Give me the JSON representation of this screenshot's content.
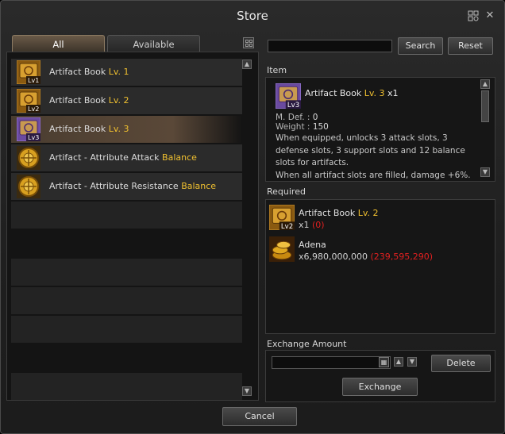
{
  "window": {
    "title": "Store"
  },
  "tabs": [
    {
      "label": "All",
      "active": true
    },
    {
      "label": "Available",
      "active": false
    }
  ],
  "list": [
    {
      "name": "Artifact Book",
      "suffix": "Lv. 1",
      "icon": "artifact-book-lv1-icon",
      "badge": "Lv1"
    },
    {
      "name": "Artifact Book",
      "suffix": "Lv. 2",
      "icon": "artifact-book-lv2-icon",
      "badge": "Lv2"
    },
    {
      "name": "Artifact Book",
      "suffix": "Lv. 3",
      "icon": "artifact-book-lv3-icon",
      "badge": "Lv3"
    },
    {
      "name": "Artifact - Attribute Attack",
      "suffix": "Balance",
      "icon": "artifact-attack-icon"
    },
    {
      "name": "Artifact - Attribute Resistance",
      "suffix": "Balance",
      "icon": "artifact-resistance-icon"
    }
  ],
  "search": {
    "value": "",
    "search_label": "Search",
    "reset_label": "Reset"
  },
  "item": {
    "section_label": "Item",
    "name": "Artifact Book",
    "level": "Lv. 3",
    "qty": "x1",
    "badge": "Lv3",
    "mdef_label": "M. Def. :",
    "mdef_value": "0",
    "weight_label": "Weight :",
    "weight_value": "150",
    "description": "When equipped, unlocks 3 attack slots, 3 defense slots, 3 support slots and 12 balance slots for artifacts.",
    "description2": "When all artifact slots are filled, damage +6%."
  },
  "required": {
    "section_label": "Required",
    "entries": [
      {
        "name": "Artifact Book",
        "level": "Lv. 2",
        "qty": "x1",
        "owned": "(0)",
        "badge": "Lv2"
      },
      {
        "name": "Adena",
        "qty": "x6,980,000,000",
        "owned": "(239,595,290)"
      }
    ]
  },
  "exchange": {
    "section_label": "Exchange Amount",
    "value": "",
    "delete_label": "Delete",
    "exchange_label": "Exchange",
    "cancel_label": "Cancel"
  },
  "colors": {
    "highlight": "#f0c030",
    "deficit": "#e02020",
    "selected_row": "#5a4838"
  }
}
